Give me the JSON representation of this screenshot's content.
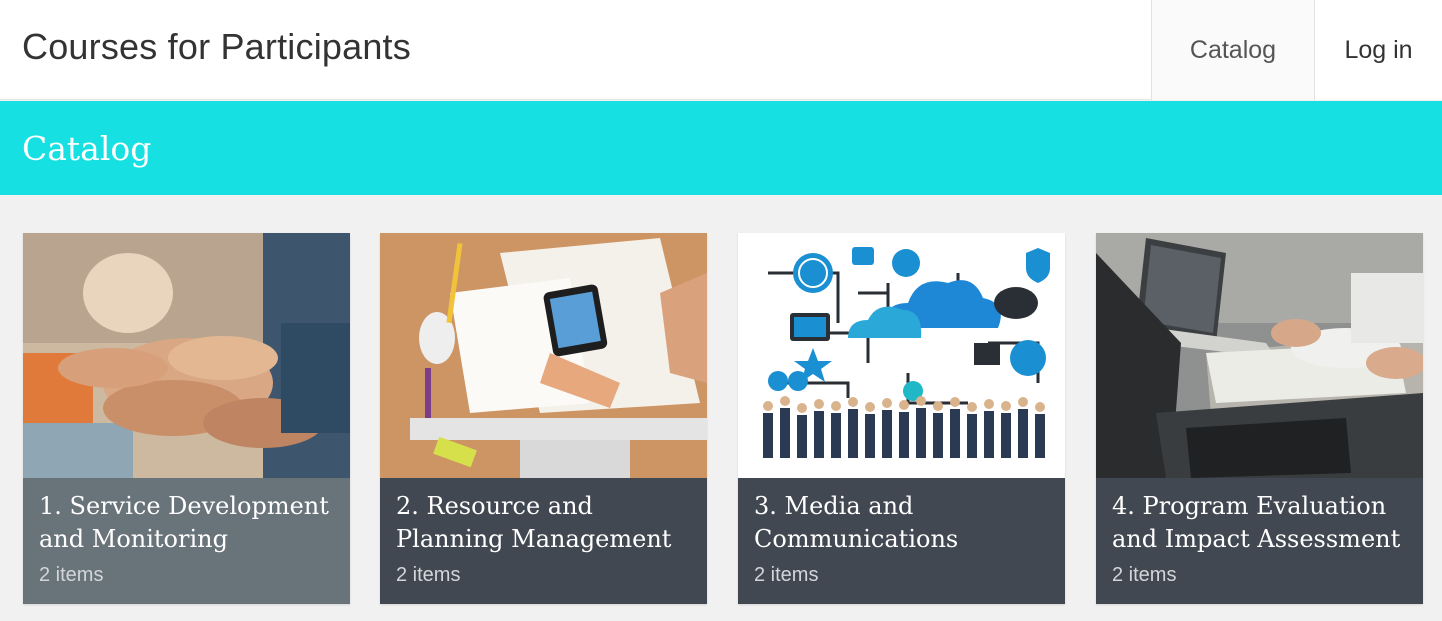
{
  "header": {
    "site_title": "Courses for Participants",
    "nav": [
      {
        "label": "Catalog"
      },
      {
        "label": "Log in"
      }
    ]
  },
  "banner": {
    "title": "Catalog"
  },
  "courses": [
    {
      "title": "1. Service Development and Monitoring",
      "count": "2 items",
      "image": "hands-together-photo"
    },
    {
      "title": "2. Resource and Planning Management",
      "count": "2 items",
      "image": "desk-planning-photo"
    },
    {
      "title": "3. Media and Communications",
      "count": "2 items",
      "image": "network-icons-illustration"
    },
    {
      "title": "4. Program Evaluation and Impact Assessment",
      "count": "2 items",
      "image": "laptop-meeting-photo"
    }
  ],
  "colors": {
    "banner": "#17e0e2",
    "card_body": "#424851",
    "card_body_hover": "#69737a"
  }
}
